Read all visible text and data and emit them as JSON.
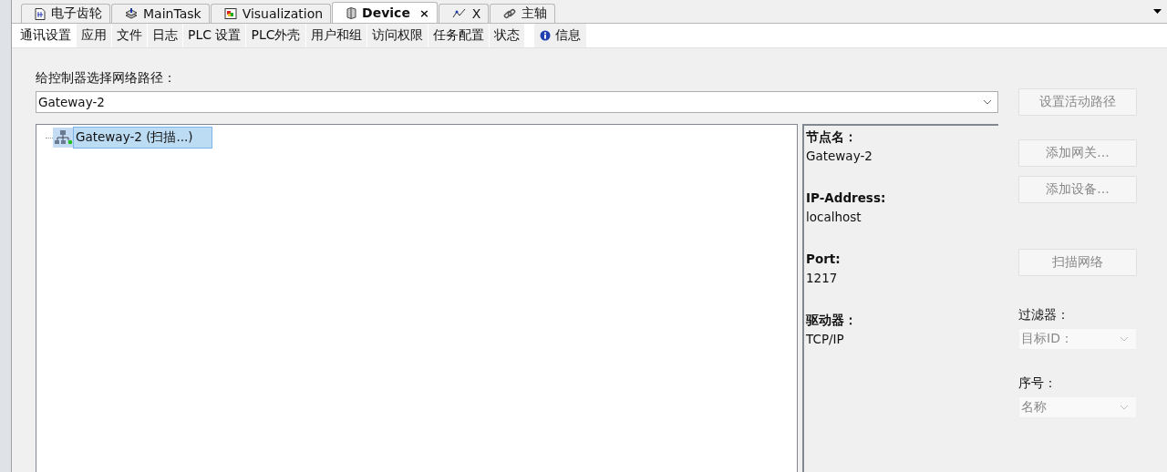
{
  "doc_tabs": [
    {
      "label": "电子齿轮",
      "selected": false
    },
    {
      "label": "MainTask",
      "selected": false
    },
    {
      "label": "Visualization",
      "selected": false
    },
    {
      "label": "Device",
      "selected": true,
      "close": "×"
    },
    {
      "label": "X",
      "selected": false
    },
    {
      "label": "主轴",
      "selected": false
    }
  ],
  "sub_tabs": [
    {
      "label": "通讯设置",
      "selected": true
    },
    {
      "label": "应用",
      "selected": false
    },
    {
      "label": "文件",
      "selected": false
    },
    {
      "label": "日志",
      "selected": false
    },
    {
      "label": "PLC 设置",
      "selected": false
    },
    {
      "label": "PLC外壳",
      "selected": false
    },
    {
      "label": "用户和组",
      "selected": false
    },
    {
      "label": "访问权限",
      "selected": false
    },
    {
      "label": "任务配置",
      "selected": false
    },
    {
      "label": "状态",
      "selected": false
    },
    {
      "label": "信息",
      "selected": false,
      "kind": "info"
    }
  ],
  "path_label": "给控制器选择网络路径：",
  "path_combo": {
    "value": "Gateway-2"
  },
  "tree": [
    {
      "label": "Gateway-2 (扫描...)",
      "selected": true,
      "color": "#22c022"
    }
  ],
  "info": [
    {
      "label": "节点名：",
      "value": "Gateway-2"
    },
    {
      "label": "IP-Address:",
      "value": "localhost"
    },
    {
      "label": "Port:",
      "value": "1217"
    },
    {
      "label": "驱动器：",
      "value": "TCP/IP"
    }
  ],
  "buttons": [
    {
      "label": "设置活动路径",
      "disabled": true
    },
    {
      "label": "添加网关...",
      "disabled": true
    },
    {
      "label": "添加设备...",
      "disabled": true
    },
    {
      "label": "扫描网络",
      "disabled": true
    }
  ],
  "filter": {
    "label": "过滤器：",
    "value": "目标ID：",
    "disabled": true
  },
  "sort": {
    "label": "序号：",
    "value": "名称",
    "disabled": true
  }
}
